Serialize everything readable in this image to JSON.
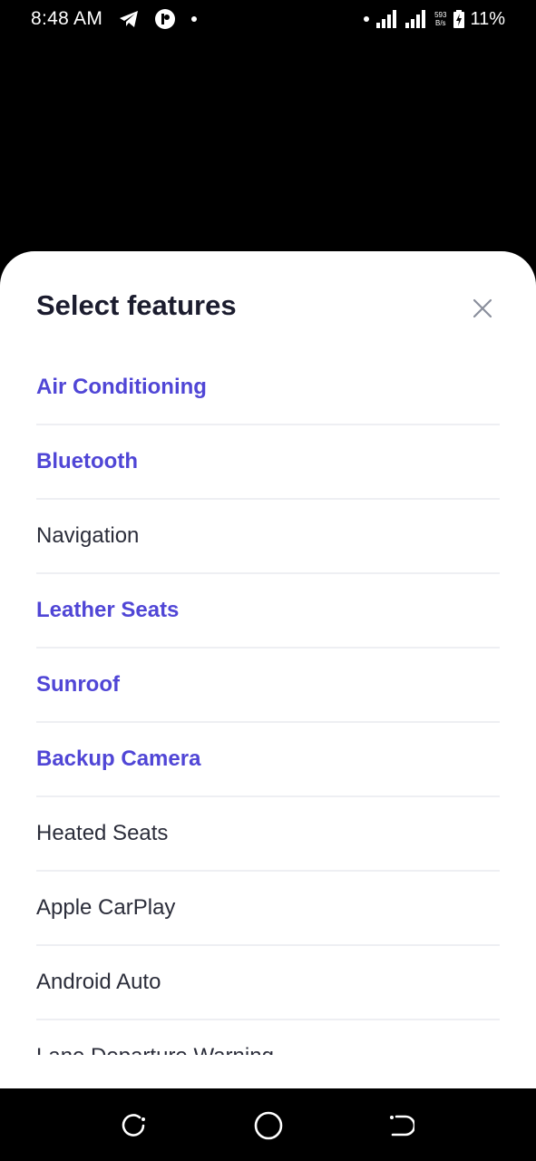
{
  "status_bar": {
    "time": "8:48 AM",
    "net_speed_value": "593",
    "net_speed_unit": "B/s",
    "battery": "11%",
    "icons": [
      "telegram-icon",
      "app-notification-icon",
      "dot-icon",
      "dot-icon",
      "signal-icon",
      "signal-icon",
      "battery-charging-icon"
    ]
  },
  "sheet": {
    "title": "Select features",
    "close_icon": "close-icon",
    "accent_color": "#5046d6",
    "features": [
      {
        "label": "Air Conditioning",
        "selected": true
      },
      {
        "label": "Bluetooth",
        "selected": true
      },
      {
        "label": "Navigation",
        "selected": false
      },
      {
        "label": "Leather Seats",
        "selected": true
      },
      {
        "label": "Sunroof",
        "selected": true
      },
      {
        "label": "Backup Camera",
        "selected": true
      },
      {
        "label": "Heated Seats",
        "selected": false
      },
      {
        "label": "Apple CarPlay",
        "selected": false
      },
      {
        "label": "Android Auto",
        "selected": false
      },
      {
        "label": "Lane Departure Warning",
        "selected": false
      }
    ]
  },
  "nav_bar": {
    "buttons": [
      "recents-icon",
      "home-icon",
      "back-icon"
    ]
  }
}
